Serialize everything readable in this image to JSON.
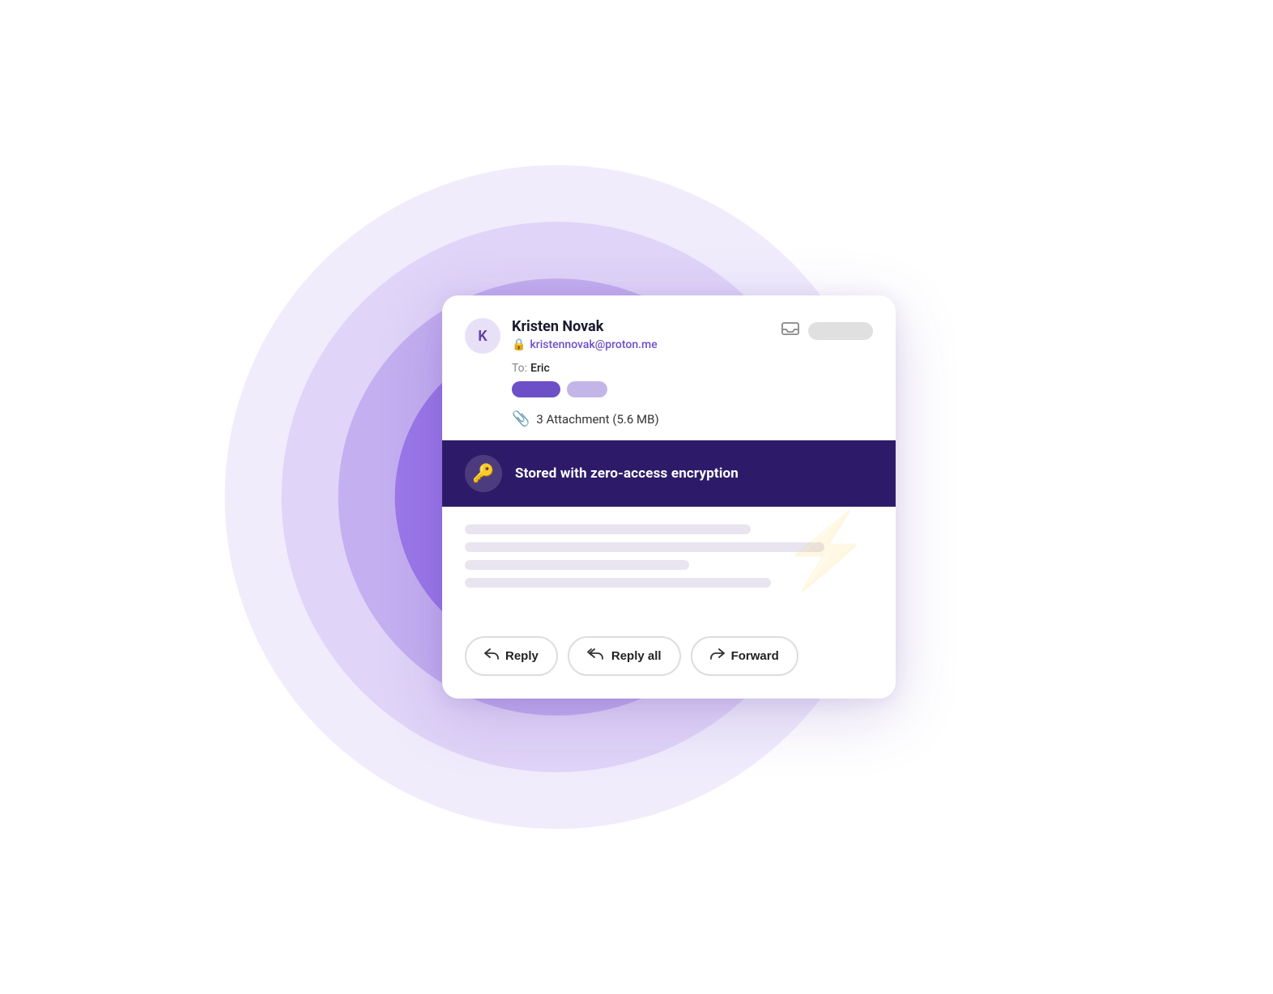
{
  "background": {
    "circles": [
      {
        "size": 820,
        "color": "#f0ecfc",
        "opacity": 1
      },
      {
        "size": 680,
        "color": "#e0d5f8",
        "opacity": 1
      },
      {
        "size": 540,
        "color": "#c4b0f0",
        "opacity": 1
      },
      {
        "size": 400,
        "color": "#9b7de8",
        "opacity": 1
      },
      {
        "size": 260,
        "color": "#7b4fcc",
        "opacity": 1
      },
      {
        "size": 130,
        "color": "#5e30b5",
        "opacity": 1
      }
    ]
  },
  "card": {
    "avatar_letter": "K",
    "sender_name": "Kristen Novak",
    "sender_email": "kristennovak@proton.me",
    "to_label": "To:",
    "to_name": "Eric",
    "attachment_text": "3 Attachment (5.6 MB)",
    "encryption_label": "Stored with zero-access encryption",
    "content_lines": [
      {
        "width": "70%"
      },
      {
        "width": "88%"
      },
      {
        "width": "55%"
      },
      {
        "width": "75%"
      }
    ],
    "buttons": [
      {
        "id": "reply",
        "label": "Reply",
        "icon": "↩"
      },
      {
        "id": "reply-all",
        "label": "Reply all",
        "icon": "↩↩"
      },
      {
        "id": "forward",
        "label": "Forward",
        "icon": "↗"
      }
    ]
  }
}
